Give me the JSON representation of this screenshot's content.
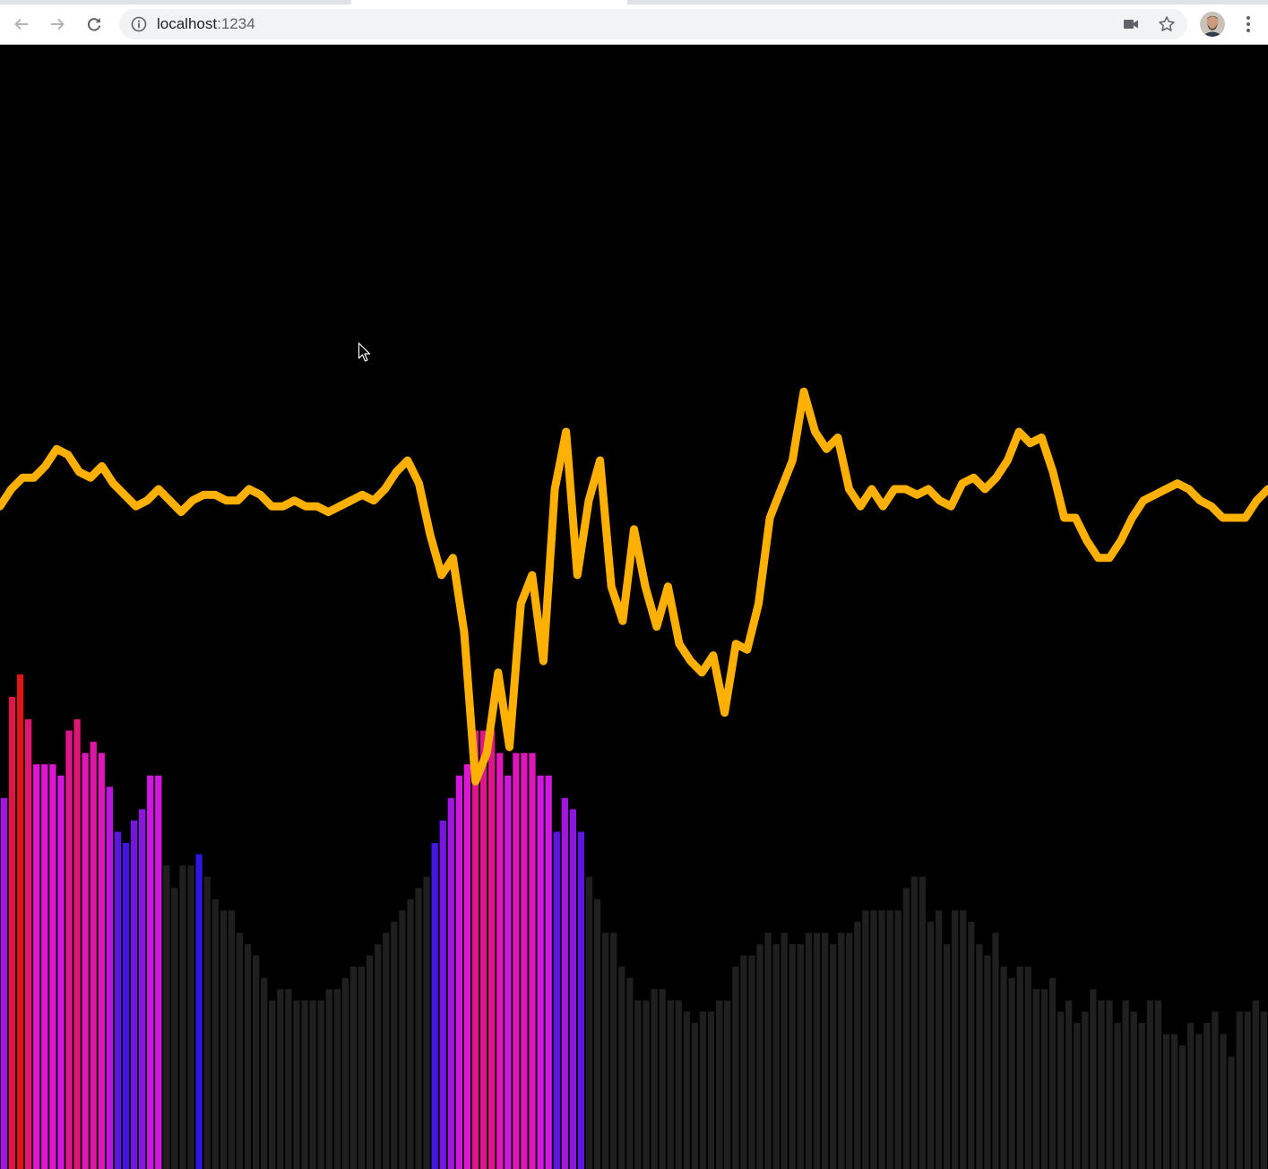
{
  "browser": {
    "url_host": "localhost",
    "url_port": ":1234",
    "icons": {
      "back": "arrow-left-icon",
      "forward": "arrow-right-icon",
      "reload": "reload-icon",
      "site_info": "info-icon",
      "camera": "video-camera-icon",
      "bookmark": "star-icon",
      "profile": "avatar",
      "menu": "kebab-menu-icon"
    }
  },
  "visualizer": {
    "background": "#000000",
    "waveform_color": "#ffb000",
    "inactive_bar_color": "#1f1f1f",
    "bar_levels": [
      0.33,
      0.42,
      0.44,
      0.4,
      0.36,
      0.36,
      0.36,
      0.35,
      0.39,
      0.4,
      0.37,
      0.38,
      0.37,
      0.34,
      0.3,
      0.29,
      0.31,
      0.32,
      0.35,
      0.35,
      0.27,
      0.25,
      0.27,
      0.27,
      0.28,
      0.26,
      0.24,
      0.23,
      0.23,
      0.21,
      0.2,
      0.19,
      0.17,
      0.15,
      0.16,
      0.16,
      0.15,
      0.15,
      0.15,
      0.15,
      0.16,
      0.16,
      0.17,
      0.18,
      0.18,
      0.19,
      0.2,
      0.21,
      0.22,
      0.23,
      0.24,
      0.25,
      0.26,
      0.29,
      0.31,
      0.33,
      0.35,
      0.36,
      0.39,
      0.39,
      0.39,
      0.37,
      0.35,
      0.37,
      0.37,
      0.37,
      0.35,
      0.35,
      0.3,
      0.33,
      0.32,
      0.3,
      0.26,
      0.24,
      0.21,
      0.21,
      0.18,
      0.17,
      0.15,
      0.15,
      0.16,
      0.16,
      0.15,
      0.15,
      0.14,
      0.13,
      0.14,
      0.14,
      0.15,
      0.15,
      0.18,
      0.19,
      0.19,
      0.2,
      0.21,
      0.2,
      0.21,
      0.2,
      0.2,
      0.21,
      0.21,
      0.21,
      0.2,
      0.21,
      0.21,
      0.22,
      0.23,
      0.23,
      0.23,
      0.23,
      0.23,
      0.25,
      0.26,
      0.26,
      0.22,
      0.23,
      0.2,
      0.23,
      0.23,
      0.22,
      0.2,
      0.19,
      0.21,
      0.18,
      0.17,
      0.18,
      0.18,
      0.16,
      0.16,
      0.17,
      0.14,
      0.15,
      0.13,
      0.14,
      0.16,
      0.15,
      0.15,
      0.13,
      0.15,
      0.14,
      0.13,
      0.15,
      0.15,
      0.12,
      0.12,
      0.11,
      0.13,
      0.12,
      0.13,
      0.14,
      0.12,
      0.1,
      0.14,
      0.14,
      0.15,
      0.14
    ],
    "waveform_levels": [
      0.32,
      0.35,
      0.37,
      0.37,
      0.39,
      0.42,
      0.41,
      0.38,
      0.37,
      0.39,
      0.36,
      0.34,
      0.32,
      0.33,
      0.35,
      0.33,
      0.31,
      0.33,
      0.34,
      0.34,
      0.33,
      0.33,
      0.35,
      0.34,
      0.32,
      0.32,
      0.33,
      0.32,
      0.32,
      0.31,
      0.32,
      0.33,
      0.34,
      0.33,
      0.35,
      0.38,
      0.4,
      0.36,
      0.27,
      0.2,
      0.23,
      0.1,
      -0.16,
      -0.11,
      0.03,
      -0.1,
      0.15,
      0.2,
      0.05,
      0.35,
      0.45,
      0.2,
      0.33,
      0.4,
      0.18,
      0.12,
      0.28,
      0.18,
      0.11,
      0.18,
      0.08,
      0.05,
      0.03,
      0.06,
      -0.04,
      0.08,
      0.07,
      0.15,
      0.3,
      0.35,
      0.4,
      0.52,
      0.45,
      0.42,
      0.44,
      0.35,
      0.32,
      0.35,
      0.32,
      0.35,
      0.35,
      0.34,
      0.35,
      0.33,
      0.32,
      0.36,
      0.37,
      0.35,
      0.37,
      0.4,
      0.45,
      0.43,
      0.44,
      0.38,
      0.3,
      0.3,
      0.26,
      0.23,
      0.23,
      0.26,
      0.3,
      0.33,
      0.34,
      0.35,
      0.36,
      0.35,
      0.33,
      0.32,
      0.3,
      0.3,
      0.3,
      0.33,
      0.35
    ]
  }
}
